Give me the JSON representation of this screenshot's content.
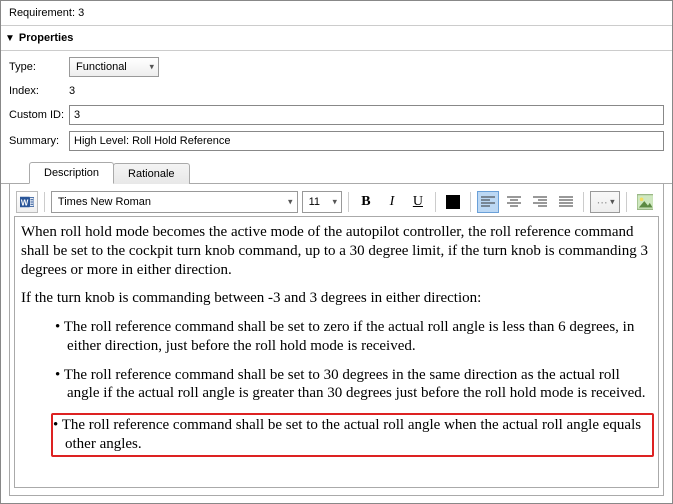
{
  "header": {
    "title": "Requirement: 3"
  },
  "section": {
    "properties_label": "Properties"
  },
  "form": {
    "type_label": "Type:",
    "type_value": "Functional",
    "index_label": "Index:",
    "index_value": "3",
    "customid_label": "Custom ID:",
    "customid_value": "3",
    "summary_label": "Summary:",
    "summary_value": "High Level: Roll Hold Reference"
  },
  "tabs": {
    "description": "Description",
    "rationale": "Rationale"
  },
  "toolbar": {
    "font_family": "Times New Roman",
    "font_size": "11",
    "bold": "B",
    "italic": "I",
    "underline": "U"
  },
  "content": {
    "para1": "When roll hold mode becomes the active mode of the autopilot controller, the roll reference command shall be set to the cockpit turn knob command, up to a 30 degree limit, if the turn knob is commanding 3 degrees or more in either direction.",
    "para2": "If the turn knob is commanding between -3 and 3 degrees in either direction:",
    "bullet1": "The roll reference command shall be set to zero if the actual roll angle is less than 6 degrees, in either direction, just before the roll hold mode is received.",
    "bullet2": "The roll reference command shall be set to 30 degrees in the same direction as the actual roll angle if the actual roll angle is greater than 30 degrees just before the roll hold mode is received.",
    "bullet3": "The roll reference command shall be set to the actual roll angle when the actual roll angle equals other angles."
  }
}
